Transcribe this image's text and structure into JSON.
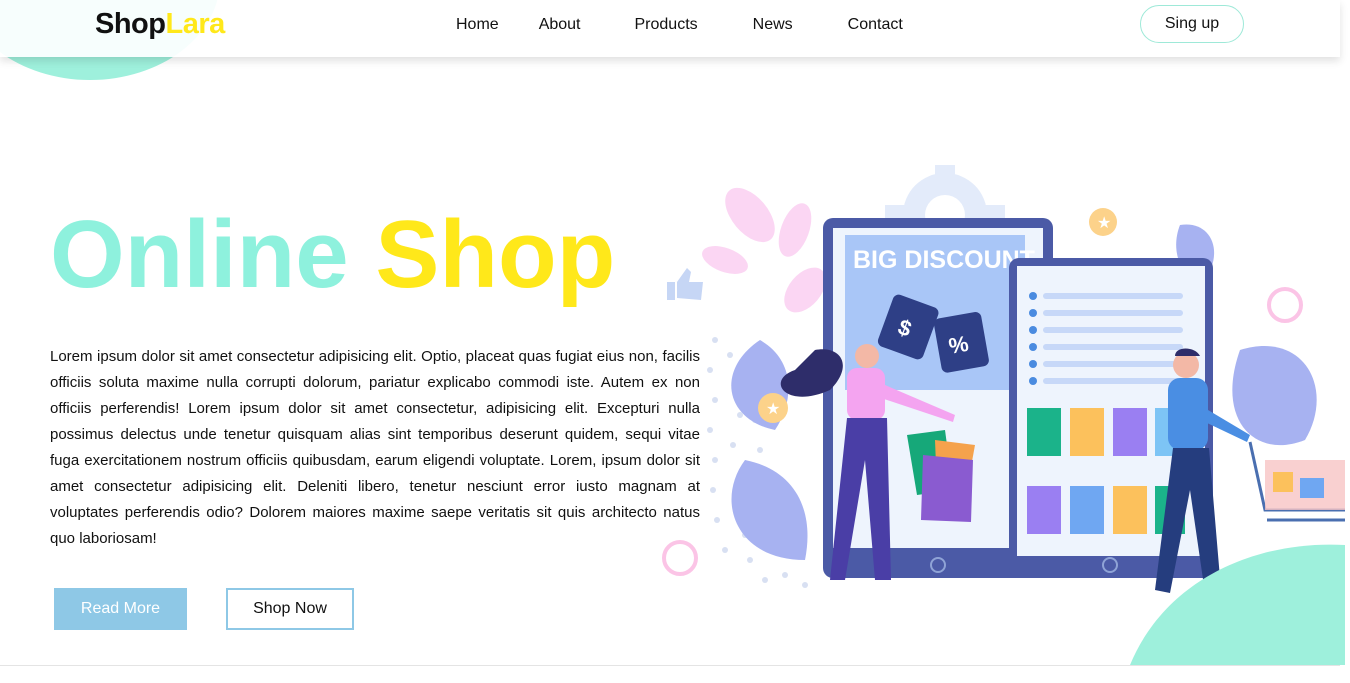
{
  "logo": {
    "part1": "Shop",
    "part2": "Lara"
  },
  "nav": {
    "items": [
      "Home",
      "About",
      "Products",
      "News",
      "Contact"
    ]
  },
  "header": {
    "signup_label": "Sing up"
  },
  "hero": {
    "title_part1": "Online",
    "title_part2": "Shop",
    "description": "Lorem ipsum dolor sit amet consectetur adipisicing elit. Optio, placeat quas fugiat eius non, facilis officiis soluta maxime nulla corrupti dolorum, pariatur explicabo commodi iste. Autem ex non officiis perferendis! Lorem ipsum dolor sit amet consectetur, adipisicing elit. Excepturi nulla possimus delectus unde tenetur quisquam alias sint temporibus deserunt quidem, sequi vitae fuga exercitationem nostrum officiis quibusdam, earum eligendi voluptate. Lorem, ipsum dolor sit amet consectetur adipisicing elit. Deleniti libero, tenetur nesciunt error iusto magnam at voluptates perferendis odio? Dolorem maiores maxime saepe veritatis sit quis architecto natus quo laboriosam!",
    "read_more_label": "Read More",
    "shop_now_label": "Shop Now"
  },
  "illustration": {
    "banner_text": "BIG DISCOUNT",
    "tag1_symbol": "$",
    "tag2_symbol": "%"
  },
  "colors": {
    "mint": "#9ef0dc",
    "yellow": "#ffe81a",
    "light_blue": "#8ec8e6",
    "indigo": "#4b4fa6"
  }
}
